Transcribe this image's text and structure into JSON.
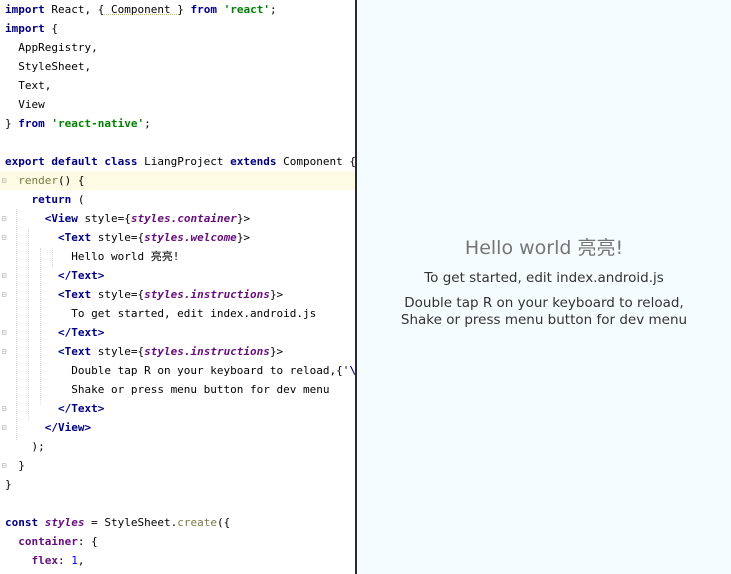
{
  "editor": {
    "lines": [
      {
        "tokens": [
          {
            "t": "import",
            "c": "kw"
          },
          {
            "t": " React, "
          },
          {
            "t": "{",
            "c": ""
          },
          {
            "t": " Component ",
            "c": "sq"
          },
          {
            "t": "}"
          },
          {
            "t": " from ",
            "c": "kw"
          },
          {
            "t": "'react'",
            "c": "str"
          },
          {
            "t": ";"
          }
        ]
      },
      {
        "tokens": [
          {
            "t": "import",
            "c": "kw"
          },
          {
            "t": " {"
          }
        ]
      },
      {
        "tokens": [
          {
            "t": "  AppRegistry,"
          }
        ]
      },
      {
        "tokens": [
          {
            "t": "  StyleSheet,"
          }
        ]
      },
      {
        "tokens": [
          {
            "t": "  Text,"
          }
        ]
      },
      {
        "tokens": [
          {
            "t": "  View"
          }
        ]
      },
      {
        "tokens": [
          {
            "t": "} "
          },
          {
            "t": "from",
            "c": "kw"
          },
          {
            "t": " "
          },
          {
            "t": "'react-native'",
            "c": "str"
          },
          {
            "t": ";"
          }
        ]
      },
      {
        "tokens": [
          {
            "t": ""
          }
        ]
      },
      {
        "tokens": [
          {
            "t": "export default class",
            "c": "kw"
          },
          {
            "t": " LiangProject "
          },
          {
            "t": "extends",
            "c": "kw"
          },
          {
            "t": " Component {"
          }
        ]
      },
      {
        "tokens": [
          {
            "t": "  "
          },
          {
            "t": "render",
            "c": "method"
          },
          {
            "t": "() {"
          }
        ],
        "current": true
      },
      {
        "tokens": [
          {
            "t": "    "
          },
          {
            "t": "return",
            "c": "kw"
          },
          {
            "t": " ("
          }
        ]
      },
      {
        "tokens": [
          {
            "t": "      "
          },
          {
            "t": "<View",
            "c": "tag"
          },
          {
            "t": " style={"
          },
          {
            "t": "styles.container",
            "c": "ital"
          },
          {
            "t": "}>"
          }
        ]
      },
      {
        "tokens": [
          {
            "t": "        "
          },
          {
            "t": "<Text",
            "c": "tag"
          },
          {
            "t": " style={"
          },
          {
            "t": "styles.welcome",
            "c": "ital"
          },
          {
            "t": "}>"
          }
        ]
      },
      {
        "tokens": [
          {
            "t": "          Hello world 亮亮!"
          }
        ]
      },
      {
        "tokens": [
          {
            "t": "        "
          },
          {
            "t": "</Text>",
            "c": "tag"
          }
        ]
      },
      {
        "tokens": [
          {
            "t": "        "
          },
          {
            "t": "<Text",
            "c": "tag"
          },
          {
            "t": " style={"
          },
          {
            "t": "styles.instructions",
            "c": "ital"
          },
          {
            "t": "}>"
          }
        ]
      },
      {
        "tokens": [
          {
            "t": "          To get started, edit index.android.js"
          }
        ]
      },
      {
        "tokens": [
          {
            "t": "        "
          },
          {
            "t": "</Text>",
            "c": "tag"
          }
        ]
      },
      {
        "tokens": [
          {
            "t": "        "
          },
          {
            "t": "<Text",
            "c": "tag"
          },
          {
            "t": " style={"
          },
          {
            "t": "styles.instructions",
            "c": "ital"
          },
          {
            "t": "}>"
          }
        ]
      },
      {
        "tokens": [
          {
            "t": "          Double tap R on your keyboard to reload,{'"
          },
          {
            "t": "\\n",
            "c": "esc"
          },
          {
            "t": "'}"
          }
        ]
      },
      {
        "tokens": [
          {
            "t": "          Shake or press menu button for dev menu"
          }
        ]
      },
      {
        "tokens": [
          {
            "t": "        "
          },
          {
            "t": "</Text>",
            "c": "tag"
          }
        ]
      },
      {
        "tokens": [
          {
            "t": "      "
          },
          {
            "t": "</View>",
            "c": "tag"
          }
        ]
      },
      {
        "tokens": [
          {
            "t": "    );"
          }
        ]
      },
      {
        "tokens": [
          {
            "t": "  }"
          }
        ]
      },
      {
        "tokens": [
          {
            "t": "}"
          }
        ]
      },
      {
        "tokens": [
          {
            "t": ""
          }
        ]
      },
      {
        "tokens": [
          {
            "t": "const",
            "c": "kw"
          },
          {
            "t": " "
          },
          {
            "t": "styles",
            "c": "ital"
          },
          {
            "t": " = StyleSheet."
          },
          {
            "t": "create",
            "c": "method"
          },
          {
            "t": "({"
          }
        ]
      },
      {
        "tokens": [
          {
            "t": "  "
          },
          {
            "t": "container",
            "c": "prop"
          },
          {
            "t": ": {"
          }
        ]
      },
      {
        "tokens": [
          {
            "t": "    "
          },
          {
            "t": "flex",
            "c": "prop"
          },
          {
            "t": ": "
          },
          {
            "t": "1",
            "c": "num"
          },
          {
            "t": ","
          }
        ]
      }
    ]
  },
  "preview": {
    "welcome": "Hello world 亮亮!",
    "instructions1": "To get started, edit index.android.js",
    "instructions2_line1": "Double tap R on your keyboard to reload,",
    "instructions2_line2": "Shake or press menu button for dev menu"
  }
}
